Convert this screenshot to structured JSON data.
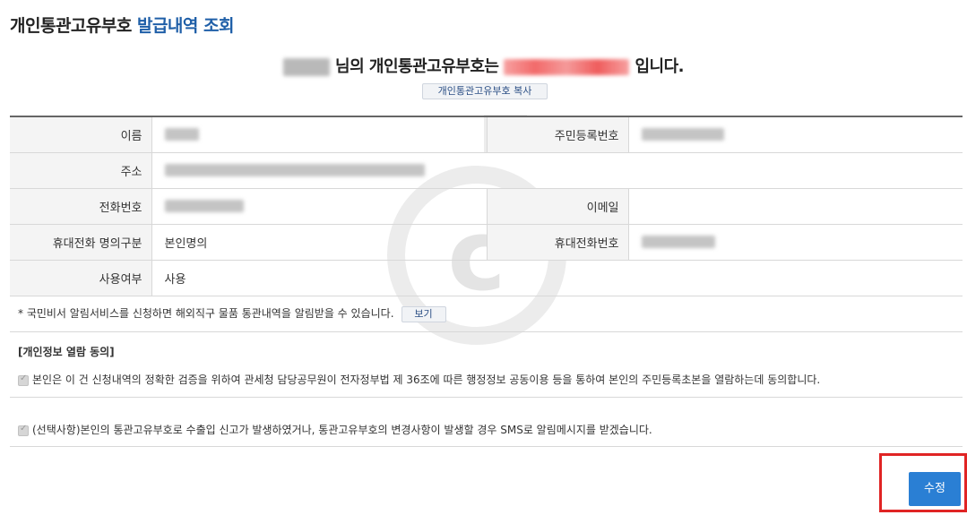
{
  "page": {
    "title_main": "개인통관고유부호",
    "title_accent": "발급내역 조회"
  },
  "summary": {
    "suffix1": "님의 개인통관고유부호는",
    "suffix2": "입니다.",
    "copy_button": "개인통관고유부호 복사"
  },
  "info": {
    "rows": [
      {
        "label": "이름",
        "label2": "주민등록번호"
      },
      {
        "label": "주소"
      },
      {
        "label": "전화번호",
        "label2": "이메일"
      },
      {
        "label": "휴대전화 명의구분",
        "value": "본인명의",
        "label2": "휴대전화번호"
      },
      {
        "label": "사용여부",
        "value": "사용"
      }
    ]
  },
  "notice": {
    "text": "* 국민비서 알림서비스를 신청하면 해외직구 물품 통관내역을 알림받을 수 있습니다.",
    "button": "보기"
  },
  "consent": {
    "title": "[개인정보 열람 동의]",
    "item1": "본인은 이 건 신청내역의 정확한 검증을 위하여 관세청 담당공무원이 전자정부법 제 36조에 따른 행정정보 공동이용 등을 통하여 본인의 주민등록초본을 열람하는데 동의합니다.",
    "item2": "(선택사항)본인의 통관고유부호로 수출입 신고가 발생하였거나, 통관고유부호의 변경사항이 발생할 경우 SMS로 알림메시지를 받겠습니다."
  },
  "actions": {
    "edit_button": "수정"
  }
}
